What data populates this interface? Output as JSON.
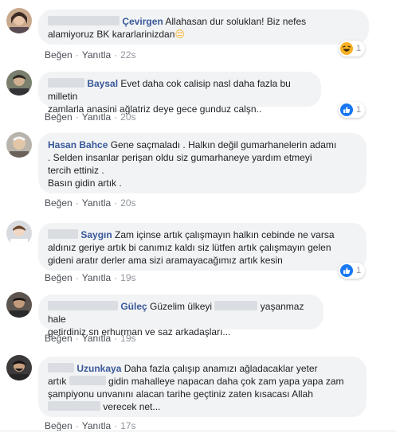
{
  "comments": [
    {
      "author": "Çevirgen",
      "text_lines": [
        "Allahasan dur soluklan! Biz nefes",
        "alamiyoruz BK kararlarinizdan"
      ],
      "emoji": "😔",
      "like_label": "Beğen",
      "reply_label": "Yanıtla",
      "time": "22s",
      "reaction": {
        "type": "haha",
        "count": "1"
      }
    },
    {
      "author": "Baysal",
      "text_lines": [
        "Evet daha cok calisip nasl daha fazla bu milletin",
        "zamlarla anasini ağlatriz deye gece gunduz calşn.."
      ],
      "like_label": "Beğen",
      "reply_label": "Yanıtla",
      "time": "20s",
      "reaction": {
        "type": "like",
        "count": "1"
      }
    },
    {
      "author": "Hasan Bahce",
      "text_lines": [
        "Gene saçmaladı . Halkın değil gumarhanelerin adamı",
        ". Selden insanlar perişan oldu siz gumarhaneye yardım etmeyi",
        "tercih ettiniz .",
        "Basın gidin artık ."
      ],
      "like_label": "Beğen",
      "reply_label": "Yanıtla",
      "time": "20s"
    },
    {
      "author": "Saygın",
      "text_lines": [
        "Zam içinse artık çalışmayın halkın cebinde ne varsa",
        "aldınız geriye artık bi canımız kaldı siz lütfen artık çalışmayın gelen",
        "gideni aratır derler ama sizi aramayacağımız artık kesin"
      ],
      "like_label": "Beğen",
      "reply_label": "Yanıtla",
      "time": "19s",
      "reaction": {
        "type": "like",
        "count": "1"
      }
    },
    {
      "author": "Güleç",
      "text_lines": [
        "Güzelim ülkeyi",
        "yaşanmaz hale",
        "getirdiniz sn erhurman ve saz arkadaşları..."
      ],
      "like_label": "Beğen",
      "reply_label": "Yanıtla",
      "time": "19s"
    },
    {
      "author": "Uzunkaya",
      "text_lines": [
        "Daha fazla çalışıp anamızı ağladacaklar yeter",
        "artık",
        "gidin mahalleye napacan daha çok zam yapa yapa zam",
        "şampiyonu unvanını alacan tarihe geçtiniz zaten kısacası Allah",
        "verecek net..."
      ],
      "like_label": "Beğen",
      "reply_label": "Yanıtla",
      "time": "17s"
    }
  ],
  "colors": {
    "name": "#385898",
    "bubble": "#f2f3f5",
    "like_blue": "#1877f2",
    "haha_yellow": "#f7b125"
  },
  "icons": {
    "haha": "haha-reaction-icon",
    "like": "like-reaction-icon"
  }
}
